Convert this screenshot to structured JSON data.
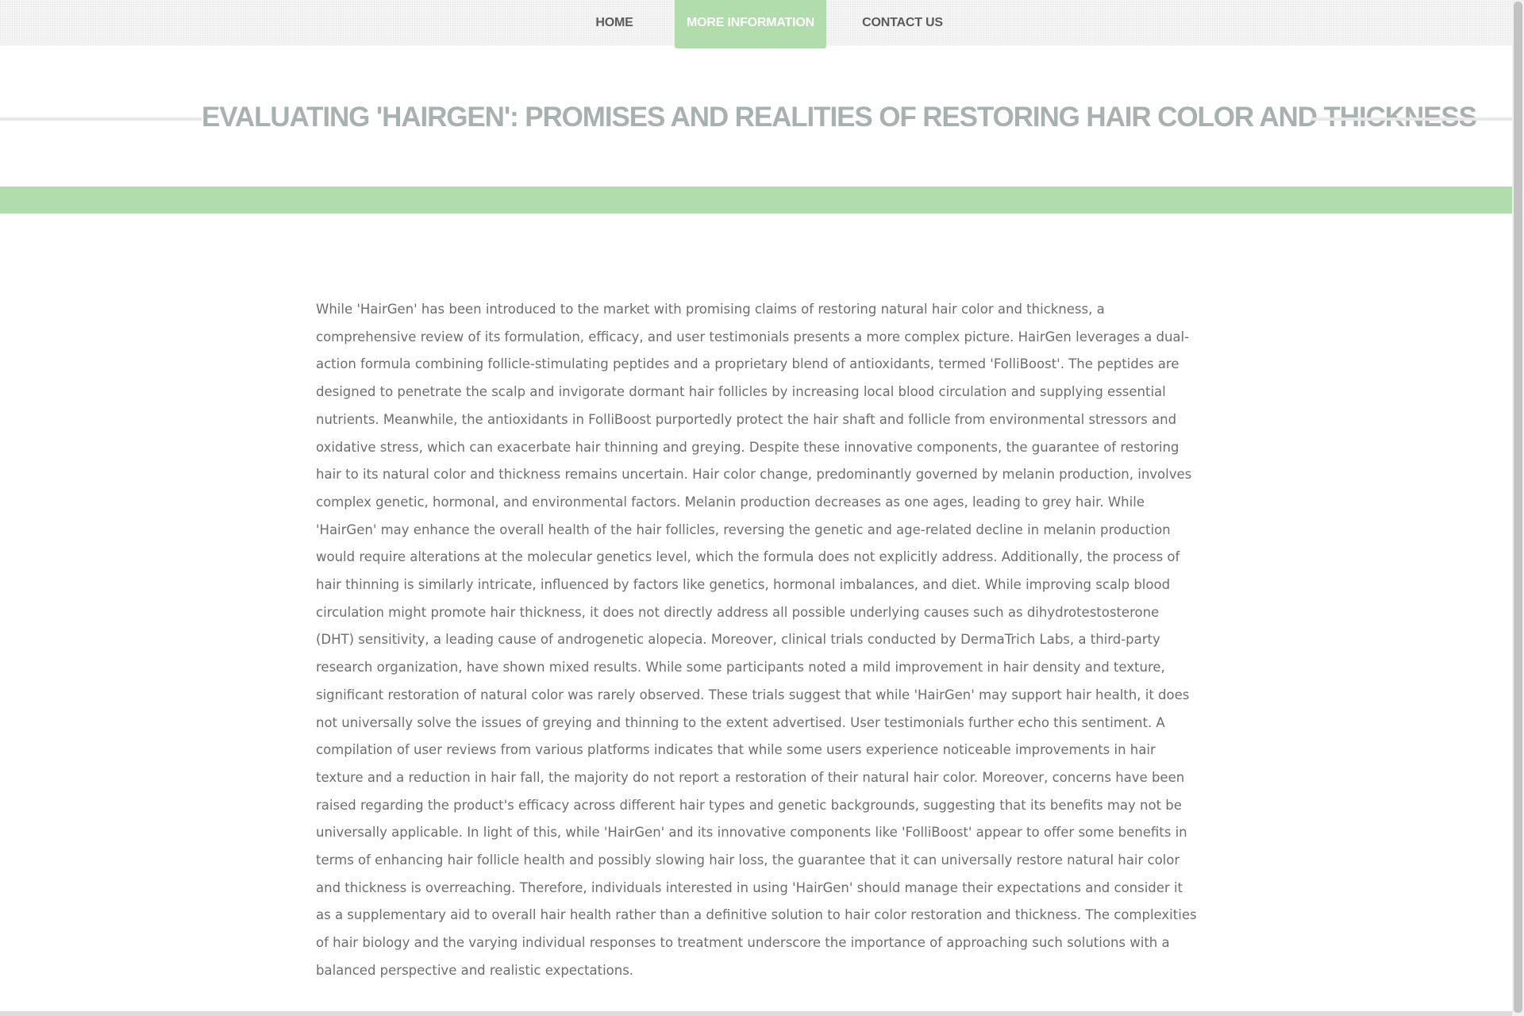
{
  "nav": {
    "items": [
      {
        "label": "HOME",
        "active": false
      },
      {
        "label": "MORE INFORMATION",
        "active": true
      },
      {
        "label": "CONTACT US",
        "active": false
      }
    ]
  },
  "page": {
    "title": "EVALUATING 'HAIRGEN': PROMISES AND REALITIES OF RESTORING HAIR COLOR AND THICKNESS"
  },
  "article": {
    "body": "While 'HairGen' has been introduced to the market with promising claims of restoring natural hair color and thickness, a comprehensive review of its formulation, efficacy, and user testimonials presents a more complex picture. HairGen leverages a dual-action formula combining follicle-stimulating peptides and a proprietary blend of antioxidants, termed 'FolliBoost'. The peptides are designed to penetrate the scalp and invigorate dormant hair follicles by increasing local blood circulation and supplying essential nutrients. Meanwhile, the antioxidants in FolliBoost purportedly protect the hair shaft and follicle from environmental stressors and oxidative stress, which can exacerbate hair thinning and greying. Despite these innovative components, the guarantee of restoring hair to its natural color and thickness remains uncertain. Hair color change, predominantly governed by melanin production, involves complex genetic, hormonal, and environmental factors. Melanin production decreases as one ages, leading to grey hair. While 'HairGen' may enhance the overall health of the hair follicles, reversing the genetic and age-related decline in melanin production would require alterations at the molecular genetics level, which the formula does not explicitly address. Additionally, the process of hair thinning is similarly intricate, influenced by factors like genetics, hormonal imbalances, and diet. While improving scalp blood circulation might promote hair thickness, it does not directly address all possible underlying causes such as dihydrotestosterone (DHT) sensitivity, a leading cause of androgenetic alopecia. Moreover, clinical trials conducted by DermaTrich Labs, a third-party research organization, have shown mixed results. While some participants noted a mild improvement in hair density and texture, significant restoration of natural color was rarely observed. These trials suggest that while 'HairGen' may support hair health, it does not universally solve the issues of greying and thinning to the extent advertised. User testimonials further echo this sentiment. A compilation of user reviews from various platforms indicates that while some users experience noticeable improvements in hair texture and a reduction in hair fall, the majority do not report a restoration of their natural hair color. Moreover, concerns have been raised regarding the product's efficacy across different hair types and genetic backgrounds, suggesting that its benefits may not be universally applicable. In light of this, while 'HairGen' and its innovative components like 'FolliBoost' appear to offer some benefits in terms of enhancing hair follicle health and possibly slowing hair loss, the guarantee that it can universally restore natural hair color and thickness is overreaching. Therefore, individuals interested in using 'HairGen' should manage their expectations and consider it as a supplementary aid to overall hair health rather than a definitive solution to hair color restoration and thickness. The complexities of hair biology and the varying individual responses to treatment underscore the importance of approaching such solutions with a balanced perspective and realistic expectations."
  },
  "colors": {
    "accent": "#b1dcab",
    "title": "#a8b0b0",
    "body_text": "#6d6d6d",
    "nav_text": "#5a5a5a"
  }
}
